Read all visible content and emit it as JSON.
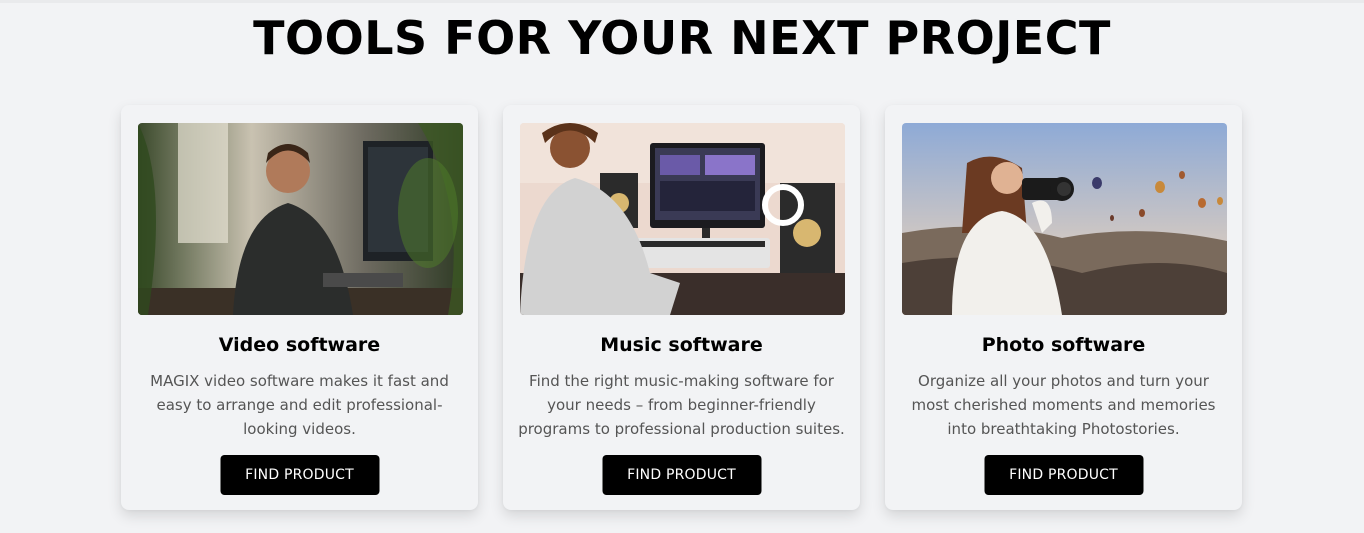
{
  "page": {
    "title": "TOOLS FOR YOUR NEXT PROJECT"
  },
  "cards": [
    {
      "title": "Video software",
      "description": "MAGIX video software makes it fast and easy to arrange and edit professional-looking videos.",
      "button_label": "FIND PRODUCT",
      "image_icon": "video-editor-photo"
    },
    {
      "title": "Music software",
      "description": "Find the right music-making software for your needs – from beginner-friendly programs to professional production suites.",
      "button_label": "FIND PRODUCT",
      "image_icon": "music-studio-photo"
    },
    {
      "title": "Photo software",
      "description": "Organize all your photos and turn your most cherished moments and memories into breathtaking Photostories.",
      "button_label": "FIND PRODUCT",
      "image_icon": "photographer-photo"
    }
  ],
  "colors": {
    "background": "#f2f3f5",
    "button": "#000000",
    "button_text": "#ffffff",
    "title": "#000000",
    "description": "#555555"
  }
}
